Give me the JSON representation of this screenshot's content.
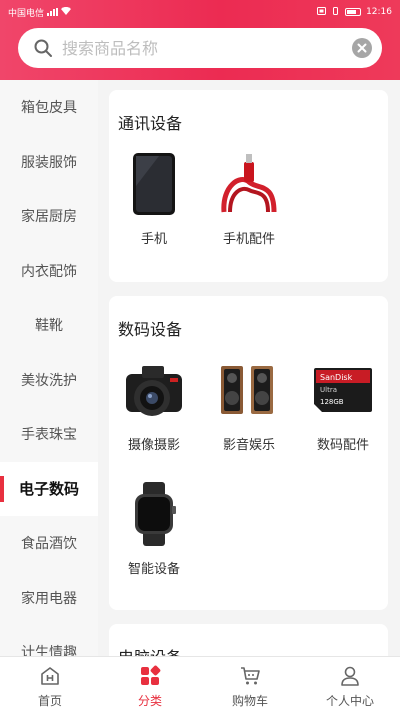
{
  "status_bar": {
    "carrier": "中国电信",
    "time": "12:16"
  },
  "search": {
    "placeholder": "搜索商品名称",
    "value": ""
  },
  "sidebar": {
    "items": [
      {
        "label": "箱包皮具",
        "active": false
      },
      {
        "label": "服装服饰",
        "active": false
      },
      {
        "label": "家居厨房",
        "active": false
      },
      {
        "label": "内衣配饰",
        "active": false
      },
      {
        "label": "鞋靴",
        "active": false
      },
      {
        "label": "美妆洗护",
        "active": false
      },
      {
        "label": "手表珠宝",
        "active": false
      },
      {
        "label": "电子数码",
        "active": true
      },
      {
        "label": "食品酒饮",
        "active": false
      },
      {
        "label": "家用电器",
        "active": false
      },
      {
        "label": "计生情趣",
        "active": false
      }
    ]
  },
  "sections": [
    {
      "title": "通讯设备",
      "items": [
        {
          "label": "手机",
          "icon": "smartphone-icon"
        },
        {
          "label": "手机配件",
          "icon": "usb-cable-icon"
        }
      ]
    },
    {
      "title": "数码设备",
      "items": [
        {
          "label": "摄像摄影",
          "icon": "camera-icon"
        },
        {
          "label": "影音娱乐",
          "icon": "speakers-icon"
        },
        {
          "label": "数码配件",
          "icon": "sd-card-icon"
        },
        {
          "label": "智能设备",
          "icon": "smartwatch-icon"
        }
      ]
    },
    {
      "title": "电脑设备",
      "items": []
    }
  ],
  "sd_card": {
    "brand": "SanDisk",
    "line": "Ultra",
    "capacity": "128GB"
  },
  "bottom_nav": {
    "items": [
      {
        "label": "首页",
        "icon": "home-icon",
        "active": false
      },
      {
        "label": "分类",
        "icon": "category-icon",
        "active": true
      },
      {
        "label": "购物车",
        "icon": "cart-icon",
        "active": false
      },
      {
        "label": "个人中心",
        "icon": "user-icon",
        "active": false
      }
    ]
  },
  "colors": {
    "accent": "#e8303f",
    "header_gradient_start": "#f0466a",
    "header_gradient_end": "#ec2b52"
  }
}
